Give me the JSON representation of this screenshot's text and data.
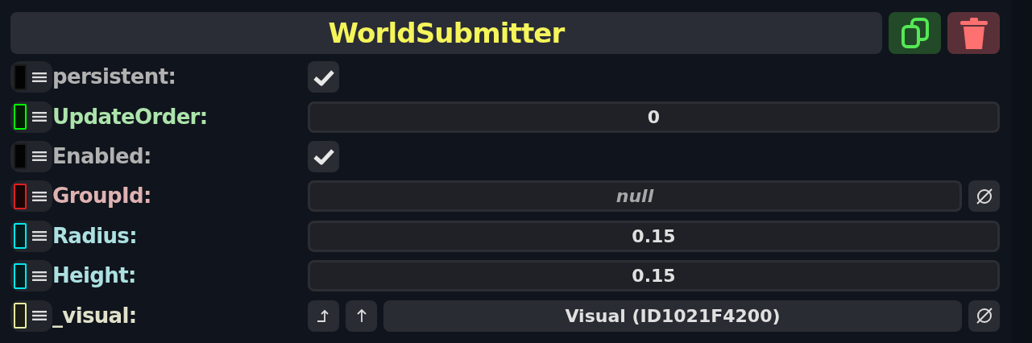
{
  "header": {
    "title": "WorldSubmitter"
  },
  "fields": [
    {
      "label": "persistent:",
      "color": "#1a1a1a",
      "kind": "checkbox",
      "checked": true
    },
    {
      "label": "UpdateOrder:",
      "color": "#00ff00",
      "kind": "number",
      "value": "0"
    },
    {
      "label": "Enabled:",
      "color": "#1a1a1a",
      "kind": "checkbox",
      "checked": true
    },
    {
      "label": "GroupId:",
      "color": "#e02020",
      "kind": "nullable",
      "value": "null"
    },
    {
      "label": "Radius:",
      "color": "#00e8f0",
      "kind": "number",
      "value": "0.15"
    },
    {
      "label": "Height:",
      "color": "#00e8f0",
      "kind": "number",
      "value": "0.15"
    },
    {
      "label": "_visual:",
      "color": "#e8f0a0",
      "kind": "reference",
      "value": "Visual (ID1021F4200)"
    }
  ]
}
